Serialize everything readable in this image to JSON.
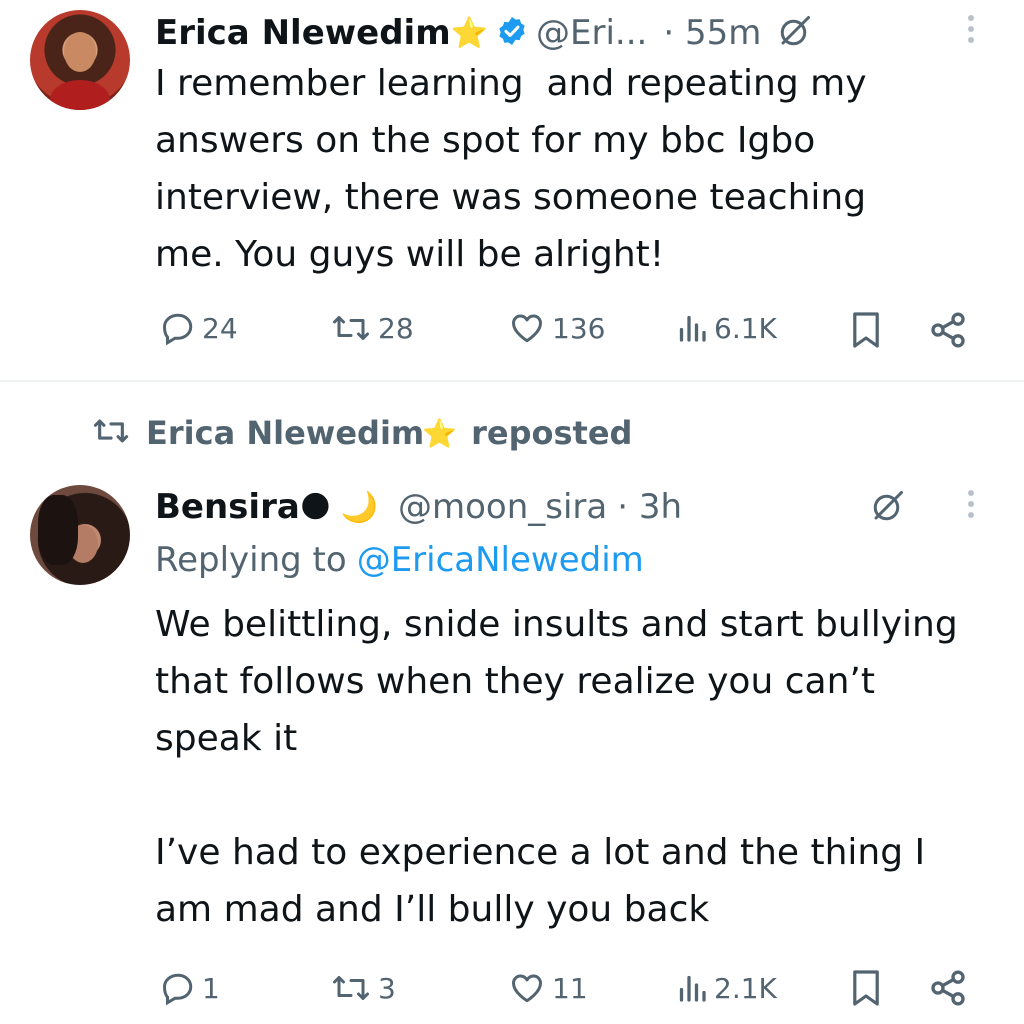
{
  "tweet1": {
    "display_name": "Erica Nlewedim",
    "name_emoji": "⭐",
    "handle": "@Eri...",
    "time": "· 55m",
    "text": "I remember learning  and repeating my answers on the spot for my bbc Igbo interview, there was someone teaching me. You guys will be alright!",
    "replies": "24",
    "reposts": "28",
    "likes": "136",
    "views": "6.1K",
    "icons": [
      "verified-badge-icon",
      "grok-icon",
      "more-icon",
      "reply-icon",
      "repost-icon",
      "like-icon",
      "views-icon",
      "bookmark-icon",
      "share-icon"
    ]
  },
  "repost_banner": {
    "name": "Erica Nlewedim",
    "emoji": "⭐",
    "label": "reposted"
  },
  "tweet2": {
    "display_name": "Bensira",
    "name_emoji": "🌑 🌙",
    "handle": "@moon_sira",
    "time": "· 3h",
    "replying_prefix": "Replying to",
    "replying_to": "@EricaNlewedim",
    "text": "We belittling, snide insults and start bullying that follows when they realize you can’t speak it\n\nI’ve had to experience a lot and the thing I am mad and I’ll bully you back",
    "replies": "1",
    "reposts": "3",
    "likes": "11",
    "views": "2.1K"
  },
  "colors": {
    "text": "#0f1419",
    "muted": "#536471",
    "link": "#1d9bf0",
    "verified": "#1d9bf0",
    "divider": "#eff3f4"
  }
}
